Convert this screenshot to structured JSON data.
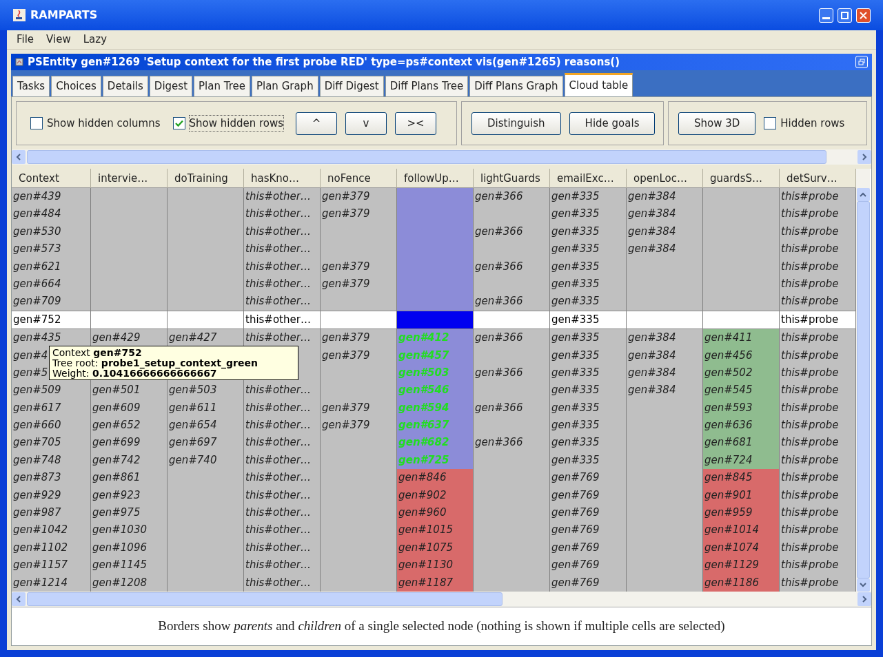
{
  "window": {
    "title": "RAMPARTS"
  },
  "menu": [
    "File",
    "View",
    "Lazy"
  ],
  "frame": {
    "title": "PSEntity gen#1269 'Setup context for the first probe RED' type=ps#context vis(gen#1265) reasons()"
  },
  "tabs": [
    {
      "label": "Tasks",
      "selected": false
    },
    {
      "label": "Choices",
      "selected": false
    },
    {
      "label": "Details",
      "selected": false
    },
    {
      "label": "Digest",
      "selected": false
    },
    {
      "label": "Plan Tree",
      "selected": false
    },
    {
      "label": "Plan Graph",
      "selected": false
    },
    {
      "label": "Diff Digest",
      "selected": false
    },
    {
      "label": "Diff Plans Tree",
      "selected": false
    },
    {
      "label": "Diff Plans Graph",
      "selected": false
    },
    {
      "label": "Cloud table",
      "selected": true
    }
  ],
  "toolbar": [
    {
      "kind": "checkbox",
      "label": "Show hidden columns",
      "checked": false
    },
    {
      "kind": "checkbox",
      "label": "Show hidden rows",
      "checked": true
    },
    {
      "kind": "button",
      "label": "^"
    },
    {
      "kind": "button",
      "label": "v"
    },
    {
      "kind": "button",
      "label": "><"
    },
    {
      "kind": "separator"
    },
    {
      "kind": "button",
      "label": "Distinguish"
    },
    {
      "kind": "button",
      "label": "Hide goals"
    },
    {
      "kind": "separator"
    },
    {
      "kind": "button",
      "label": "Show 3D"
    },
    {
      "kind": "checkbox",
      "label": "Hidden rows",
      "checked": false
    }
  ],
  "table": {
    "columns": [
      "Context",
      "intervie…",
      "doTraining",
      "hasKno…",
      "noFence",
      "followUp…",
      "lightGuards",
      "emailExc…",
      "openLoc…",
      "guardsS…",
      "detSurv…"
    ],
    "rows": [
      {
        "selected": false,
        "cells": [
          "gen#439",
          null,
          null,
          "this#other…",
          "gen#379",
          {
            "color": "#8c8cd8"
          },
          "gen#366",
          "gen#335",
          "gen#384",
          null,
          "this#probe"
        ]
      },
      {
        "selected": false,
        "cells": [
          "gen#484",
          null,
          null,
          "this#other…",
          "gen#379",
          {
            "color": "#8c8cd8"
          },
          null,
          "gen#335",
          "gen#384",
          null,
          "this#probe"
        ]
      },
      {
        "selected": false,
        "cells": [
          "gen#530",
          null,
          null,
          "this#other…",
          null,
          {
            "color": "#8c8cd8"
          },
          "gen#366",
          "gen#335",
          "gen#384",
          null,
          "this#probe"
        ]
      },
      {
        "selected": false,
        "cells": [
          "gen#573",
          null,
          null,
          "this#other…",
          null,
          {
            "color": "#8c8cd8"
          },
          null,
          "gen#335",
          "gen#384",
          null,
          "this#probe"
        ]
      },
      {
        "selected": false,
        "cells": [
          "gen#621",
          null,
          null,
          "this#other…",
          "gen#379",
          {
            "color": "#8c8cd8"
          },
          "gen#366",
          "gen#335",
          null,
          null,
          "this#probe"
        ]
      },
      {
        "selected": false,
        "cells": [
          "gen#664",
          null,
          null,
          "this#other…",
          "gen#379",
          {
            "color": "#8c8cd8"
          },
          null,
          "gen#335",
          null,
          null,
          "this#probe"
        ]
      },
      {
        "selected": false,
        "cells": [
          "gen#709",
          null,
          null,
          "this#other…",
          null,
          {
            "color": "#8c8cd8"
          },
          "gen#366",
          "gen#335",
          null,
          null,
          "this#probe"
        ]
      },
      {
        "selected": true,
        "cells": [
          "gen#752",
          null,
          null,
          "this#other…",
          null,
          {
            "color": "#0000f0"
          },
          null,
          "gen#335",
          null,
          null,
          "this#probe"
        ]
      },
      {
        "selected": false,
        "cells": [
          "gen#435",
          "gen#429",
          "gen#427",
          "this#other…",
          "gen#379",
          {
            "text": "gen#412",
            "color": "#8c8cd8",
            "kind": "linked"
          },
          "gen#366",
          "gen#335",
          "gen#384",
          {
            "text": "gen#411",
            "color": "#8fbc8f"
          },
          "this#probe"
        ]
      },
      {
        "selected": false,
        "cells": [
          "gen#4",
          null,
          null,
          null,
          "gen#379",
          {
            "text": "gen#457",
            "color": "#8c8cd8",
            "kind": "linked"
          },
          null,
          "gen#335",
          "gen#384",
          {
            "text": "gen#456",
            "color": "#8fbc8f"
          },
          "this#probe"
        ]
      },
      {
        "selected": false,
        "cells": [
          "gen#5",
          null,
          null,
          null,
          null,
          {
            "text": "gen#503",
            "color": "#8c8cd8",
            "kind": "linked"
          },
          "gen#366",
          "gen#335",
          "gen#384",
          {
            "text": "gen#502",
            "color": "#8fbc8f"
          },
          "this#probe"
        ]
      },
      {
        "selected": false,
        "cells": [
          "gen#509",
          "gen#501",
          "gen#503",
          "this#other…",
          null,
          {
            "text": "gen#546",
            "color": "#8c8cd8",
            "kind": "linked"
          },
          null,
          "gen#335",
          "gen#384",
          {
            "text": "gen#545",
            "color": "#8fbc8f"
          },
          "this#probe"
        ]
      },
      {
        "selected": false,
        "cells": [
          "gen#617",
          "gen#609",
          "gen#611",
          "this#other…",
          "gen#379",
          {
            "text": "gen#594",
            "color": "#8c8cd8",
            "kind": "linked"
          },
          "gen#366",
          "gen#335",
          null,
          {
            "text": "gen#593",
            "color": "#8fbc8f"
          },
          "this#probe"
        ]
      },
      {
        "selected": false,
        "cells": [
          "gen#660",
          "gen#652",
          "gen#654",
          "this#other…",
          "gen#379",
          {
            "text": "gen#637",
            "color": "#8c8cd8",
            "kind": "linked"
          },
          null,
          "gen#335",
          null,
          {
            "text": "gen#636",
            "color": "#8fbc8f"
          },
          "this#probe"
        ]
      },
      {
        "selected": false,
        "cells": [
          "gen#705",
          "gen#699",
          "gen#697",
          "this#other…",
          null,
          {
            "text": "gen#682",
            "color": "#8c8cd8",
            "kind": "linked"
          },
          "gen#366",
          "gen#335",
          null,
          {
            "text": "gen#681",
            "color": "#8fbc8f"
          },
          "this#probe"
        ]
      },
      {
        "selected": false,
        "cells": [
          "gen#748",
          "gen#742",
          "gen#740",
          "this#other…",
          null,
          {
            "text": "gen#725",
            "color": "#8c8cd8",
            "kind": "linked"
          },
          null,
          "gen#335",
          null,
          {
            "text": "gen#724",
            "color": "#8fbc8f"
          },
          "this#probe"
        ]
      },
      {
        "selected": false,
        "cells": [
          "gen#873",
          "gen#861",
          null,
          "this#other…",
          null,
          {
            "text": "gen#846",
            "color": "#d86a6a"
          },
          null,
          "gen#769",
          null,
          {
            "text": "gen#845",
            "color": "#d86a6a"
          },
          "this#probe"
        ]
      },
      {
        "selected": false,
        "cells": [
          "gen#929",
          "gen#923",
          null,
          "this#other…",
          null,
          {
            "text": "gen#902",
            "color": "#d86a6a"
          },
          null,
          "gen#769",
          null,
          {
            "text": "gen#901",
            "color": "#d86a6a"
          },
          "this#probe"
        ]
      },
      {
        "selected": false,
        "cells": [
          "gen#987",
          "gen#975",
          null,
          "this#other…",
          null,
          {
            "text": "gen#960",
            "color": "#d86a6a"
          },
          null,
          "gen#769",
          null,
          {
            "text": "gen#959",
            "color": "#d86a6a"
          },
          "this#probe"
        ]
      },
      {
        "selected": false,
        "cells": [
          "gen#1042",
          "gen#1030",
          null,
          "this#other…",
          null,
          {
            "text": "gen#1015",
            "color": "#d86a6a"
          },
          null,
          "gen#769",
          null,
          {
            "text": "gen#1014",
            "color": "#d86a6a"
          },
          "this#probe"
        ]
      },
      {
        "selected": false,
        "cells": [
          "gen#1102",
          "gen#1096",
          null,
          "this#other…",
          null,
          {
            "text": "gen#1075",
            "color": "#d86a6a"
          },
          null,
          "gen#769",
          null,
          {
            "text": "gen#1074",
            "color": "#d86a6a"
          },
          "this#probe"
        ]
      },
      {
        "selected": false,
        "cells": [
          "gen#1157",
          "gen#1145",
          null,
          "this#other…",
          null,
          {
            "text": "gen#1130",
            "color": "#d86a6a"
          },
          null,
          "gen#769",
          null,
          {
            "text": "gen#1129",
            "color": "#d86a6a"
          },
          "this#probe"
        ]
      },
      {
        "selected": false,
        "cells": [
          "gen#1214",
          "gen#1208",
          null,
          "this#other…",
          null,
          {
            "text": "gen#1187",
            "color": "#d86a6a"
          },
          null,
          "gen#769",
          null,
          {
            "text": "gen#1186",
            "color": "#d86a6a"
          },
          "this#probe"
        ]
      }
    ]
  },
  "tooltip": {
    "lines": [
      "Context **gen#752**",
      "Tree root: **probe1_setup_context_green**",
      "Weight: **0.10416666666666667**"
    ]
  },
  "status_bar": "Borders show *parents* and *children* of a single selected node (nothing is shown if multiple cells are selected)"
}
